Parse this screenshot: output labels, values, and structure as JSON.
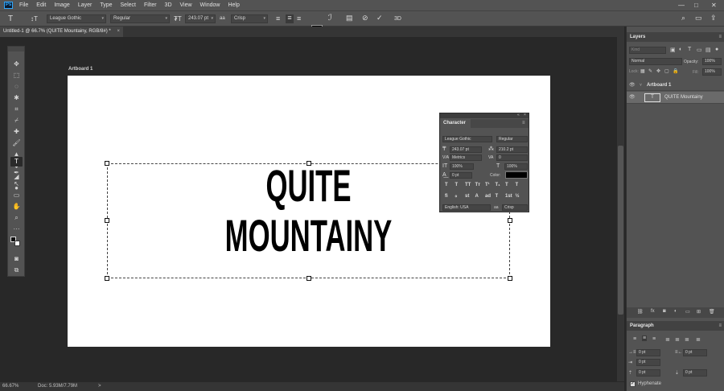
{
  "menu": [
    "File",
    "Edit",
    "Image",
    "Layer",
    "Type",
    "Select",
    "Filter",
    "3D",
    "View",
    "Window",
    "Help"
  ],
  "app_logo": "Ps",
  "window_controls": [
    "—",
    "□",
    "✕"
  ],
  "options": {
    "tool_icon": "type-tool-icon",
    "font_family": "League Gothic",
    "font_style": "Regular",
    "font_size": "243.07 pt",
    "antialias_label": "aa",
    "antialias": "Crisp",
    "text_color": "#000000",
    "cancel_icon": "cancel-icon",
    "commit_icon": "commit-check-icon",
    "three_d_label": "3D"
  },
  "document_tab": {
    "title": "Untitled-1 @ 66.7% (QUITE  Mountainy, RGB/8#) *",
    "close": "×"
  },
  "artboard": {
    "label": "Artboard 1",
    "text_line1": "QUITE",
    "text_line2": "MOUNTAINY"
  },
  "status": {
    "zoom": "66.67%",
    "doc": "Doc: 5.93M/7.79M",
    "arrow": ">"
  },
  "character": {
    "tab": "Character",
    "font_family": "League Gothic",
    "font_style": "Regular",
    "font_size": "243.07 pt",
    "leading": "210.2 pt",
    "kerning": "Metrics",
    "tracking": "0",
    "vscale": "100%",
    "hscale": "100%",
    "baseline": "0 pt",
    "color_label": "Color:",
    "color": "#000000",
    "language": "English: USA",
    "aa_label": "aa",
    "antialias": "Crisp",
    "style_buttons": [
      "T",
      "T",
      "TT",
      "Tт",
      "T¹",
      "T₁",
      "T",
      "T"
    ],
    "opentype_buttons": [
      "fi",
      "ℴ",
      "st",
      "A",
      "ad",
      "T",
      "1st",
      "½"
    ]
  },
  "layers": {
    "title": "Layers",
    "search_placeholder": "Kind",
    "blend_mode": "Normal",
    "opacity_label": "Opacity:",
    "opacity": "100%",
    "lock_label": "Lock:",
    "fill_label": "Fill:",
    "fill": "100%",
    "items": [
      {
        "name": "Artboard 1",
        "thumb": ""
      },
      {
        "name": "QUITE  Mountainy",
        "thumb": "T"
      }
    ],
    "footer_icons": [
      "link-icon",
      "fx-icon",
      "mask-icon",
      "adjustment-icon",
      "group-icon",
      "new-layer-icon",
      "trash-icon"
    ],
    "footer_glyphs": [
      "⛓",
      "fx",
      "◙",
      "◐",
      "▭",
      "⊞",
      "🗑"
    ]
  },
  "paragraph": {
    "title": "Paragraph",
    "indent_left": "0 pt",
    "indent_right": "0 pt",
    "indent_first": "0 pt",
    "space_before": "0 pt",
    "space_after": "0 pt",
    "hyphenate_label": "Hyphenate",
    "hyphenate": true
  }
}
